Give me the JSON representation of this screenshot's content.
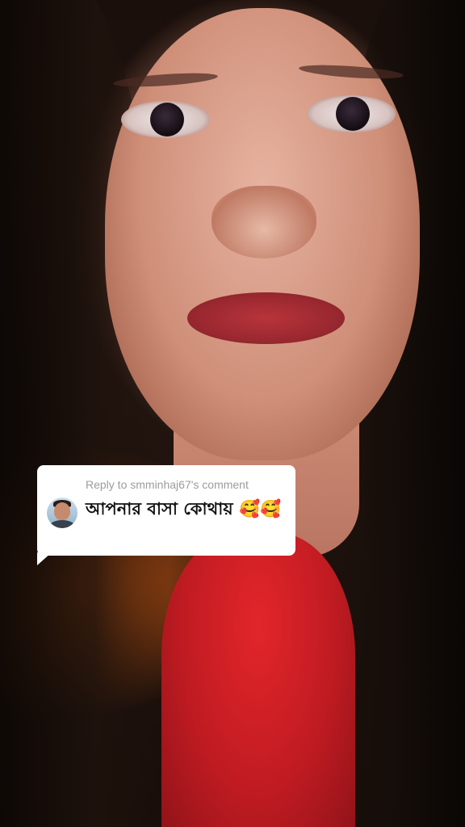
{
  "reply_sticker": {
    "header": "Reply to smminhaj67's comment",
    "comment": "আপনার বাসা কোথায় 🥰🥰",
    "avatar_icon": "user-avatar-icon",
    "background_color": "#ffffff",
    "header_color": "#9c9ca0",
    "comment_color": "#111111"
  }
}
